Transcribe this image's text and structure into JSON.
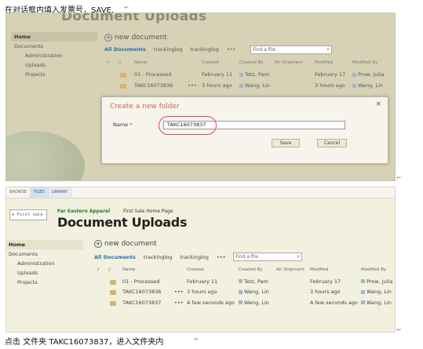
{
  "captions": {
    "top": "在对话框内填入发票号，SAVE.",
    "bottom": "点击 文件夹 TAKC16073837，进入文件夹内",
    "return_mark": "↵"
  },
  "shot1": {
    "bg_title": "Document Uploads",
    "nav": [
      "Home",
      "Documents",
      "Administration",
      "Uploads",
      "Projects"
    ],
    "new_document": "new document",
    "views": [
      "All Documents",
      "trackinglog",
      "trackinglog",
      "•••"
    ],
    "search_placeholder": "Find a file",
    "columns": [
      "Name",
      "Created",
      "Created By",
      "Air Shipment",
      "Modified",
      "Modified By"
    ],
    "rows": [
      {
        "name": "01 - Processed",
        "created": "February 11",
        "created_by": "Tetz, Pam",
        "modified": "February 17",
        "modified_by": "Prow, Julia"
      },
      {
        "name": "TAKC16073836",
        "created": "3 hours ago",
        "created_by": "Wang, Lin",
        "modified": "3 hours ago",
        "modified_by": "Wang, Lin"
      }
    ],
    "dialog": {
      "title": "Create a new folder",
      "close": "×",
      "name_label": "Name",
      "required": "*",
      "name_value": "TAKC16073837",
      "save": "Save",
      "cancel": "Cancel"
    }
  },
  "shot2": {
    "ribbon_tabs": [
      "BROWSE",
      "FILES",
      "LIBRARY"
    ],
    "logo_text": "First sale",
    "site_name": "Far Eastern Apparel",
    "site_home": "First Sale Home Page",
    "title": "Document Uploads",
    "nav": [
      "Home",
      "Documents",
      "Administration",
      "Uploads",
      "Projects"
    ],
    "new_document": "new document",
    "views": [
      "All Documents",
      "trackinglog",
      "trackinglog",
      "•••"
    ],
    "search_placeholder": "Find a file",
    "columns": [
      "Name",
      "Created",
      "Created By",
      "Air Shipment",
      "Modified",
      "Modified By"
    ],
    "rows": [
      {
        "name": "01 - Processed",
        "created": "February 11",
        "created_by": "Tetz, Pam",
        "modified": "February 17",
        "modified_by": "Prow, Julia"
      },
      {
        "name": "TAKC16073836",
        "created": "3 hours ago",
        "created_by": "Wang, Lin",
        "modified": "3 hours ago",
        "modified_by": "Wang, Lin"
      },
      {
        "name": "TAKC16073837",
        "created": "A few seconds ago",
        "created_by": "Wang, Lin",
        "modified": "A few seconds ago",
        "modified_by": "Wang, Lin"
      }
    ]
  },
  "colors": {
    "accent": "#2a6ebb",
    "dialog_title": "#cc6b4a",
    "highlight_ring": "#e04848",
    "folder": "#d8b36a"
  }
}
